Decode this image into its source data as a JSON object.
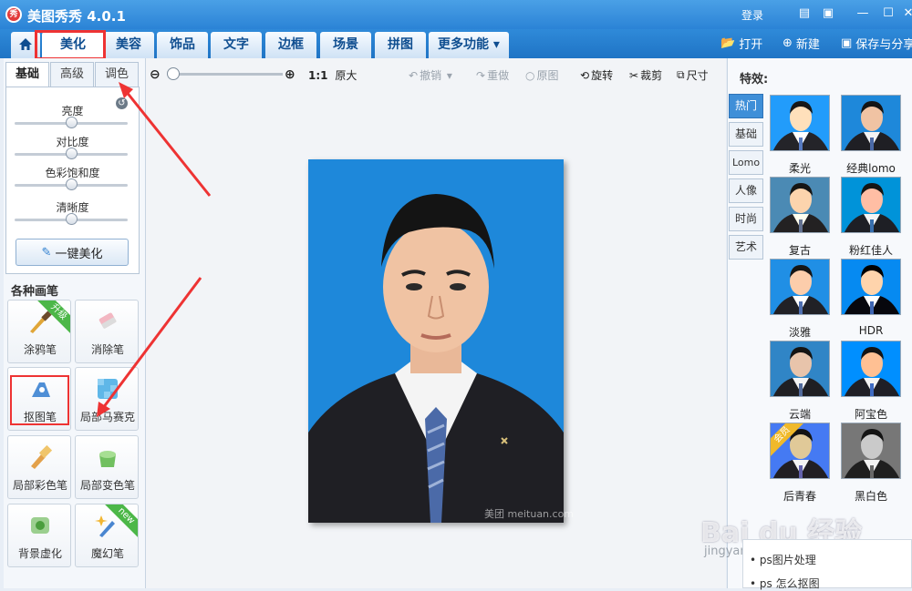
{
  "app": {
    "logo_text": "秀",
    "title": "美图秀秀 4.0.1",
    "login": "登录"
  },
  "nav": {
    "tabs": [
      "美化",
      "美容",
      "饰品",
      "文字",
      "边框",
      "场景",
      "拼图",
      "更多功能 ▾"
    ],
    "active": "美化"
  },
  "actions": {
    "open": "打开",
    "new": "新建",
    "save_share": "保存与分享"
  },
  "subtabs": [
    "基础",
    "高级",
    "调色"
  ],
  "adjust": {
    "labels": [
      "亮度",
      "对比度",
      "色彩饱和度",
      "清晰度"
    ],
    "levels": [
      0.5,
      0.5,
      0.5,
      0.5
    ],
    "one_key": "一键美化"
  },
  "brushes": {
    "heading": "各种画笔",
    "tools": [
      {
        "label": "涂鸦笔",
        "badge": "升级",
        "icon": "paintbrush-icon"
      },
      {
        "label": "消除笔",
        "badge": "",
        "icon": "eraser-icon"
      },
      {
        "label": "抠图笔",
        "badge": "",
        "icon": "cutout-pen-icon"
      },
      {
        "label": "局部马赛克",
        "badge": "",
        "icon": "mosaic-icon"
      },
      {
        "label": "局部彩色笔",
        "badge": "",
        "icon": "color-brush-icon"
      },
      {
        "label": "局部变色笔",
        "badge": "",
        "icon": "color-change-icon"
      },
      {
        "label": "背景虚化",
        "badge": "",
        "icon": "blur-icon"
      },
      {
        "label": "魔幻笔",
        "badge": "new",
        "icon": "magic-wand-icon"
      }
    ]
  },
  "toolbar": {
    "ratio": "1:1",
    "original_size": "原大",
    "undo": "撤销",
    "redo": "重做",
    "original": "原图",
    "rotate": "旋转",
    "crop": "裁剪",
    "resize": "尺寸"
  },
  "photo": {
    "watermark": "美团 meituan.com"
  },
  "effects": {
    "heading": "特效:",
    "categories": [
      "热门",
      "基础",
      "Lomo",
      "人像",
      "时尚",
      "艺术"
    ],
    "active_category": "热门",
    "items": [
      {
        "name": "柔光",
        "badge": ""
      },
      {
        "name": "经典lomo",
        "badge": ""
      },
      {
        "name": "复古",
        "badge": ""
      },
      {
        "name": "粉红佳人",
        "badge": ""
      },
      {
        "name": "淡雅",
        "badge": ""
      },
      {
        "name": "HDR",
        "badge": ""
      },
      {
        "name": "云端",
        "badge": ""
      },
      {
        "name": "阿宝色",
        "badge": ""
      },
      {
        "name": "后青春",
        "badge": "会员"
      },
      {
        "name": "黑白色",
        "badge": ""
      }
    ]
  },
  "baidu": {
    "brand": "Bai du 经验",
    "url": "jingyan.baidu.com",
    "related": [
      "ps图片处理",
      "ps 怎么抠图"
    ]
  },
  "colors": {
    "title_blue": "#2b83d6",
    "photo_bg": "#1e88da",
    "highlight_red": "#e33333",
    "badge_green": "#4cb748"
  }
}
